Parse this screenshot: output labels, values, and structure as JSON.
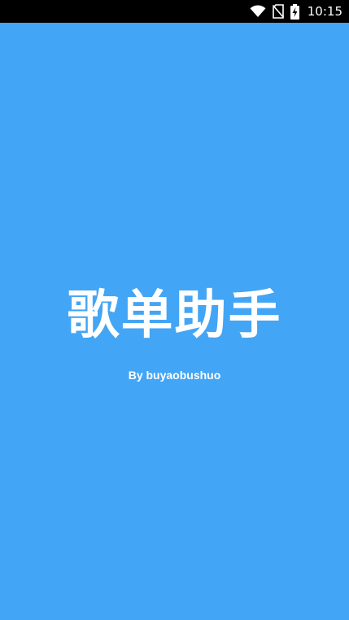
{
  "status_bar": {
    "time": "10:15",
    "battery_level": "5",
    "icons": [
      "wifi-icon",
      "no-sim-icon",
      "battery-charging-icon"
    ],
    "background": "#000000"
  },
  "splash": {
    "background": "#43a5f5",
    "title": "歌单助手",
    "author": "By buyaobushuo",
    "text_color": "#ffffff"
  }
}
